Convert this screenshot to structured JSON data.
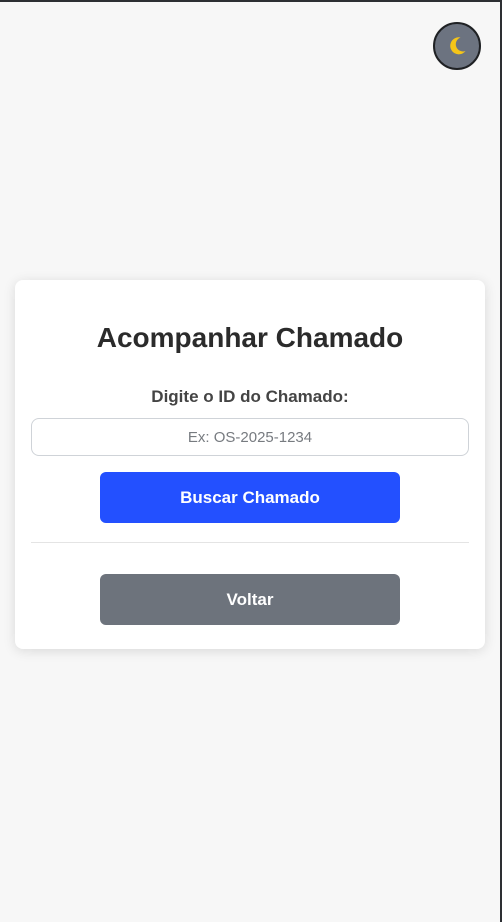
{
  "theme_toggle": {
    "icon": "moon-icon",
    "icon_color": "#f5c518",
    "background": "#6c7380"
  },
  "card": {
    "title": "Acompanhar Chamado",
    "field_label": "Digite o ID do Chamado:",
    "input": {
      "value": "",
      "placeholder": "Ex: OS-2025-1234"
    },
    "search_button_label": "Buscar Chamado",
    "back_button_label": "Voltar"
  },
  "colors": {
    "primary": "#2350ff",
    "secondary": "#6d737c",
    "page_background": "#f7f7f7"
  }
}
